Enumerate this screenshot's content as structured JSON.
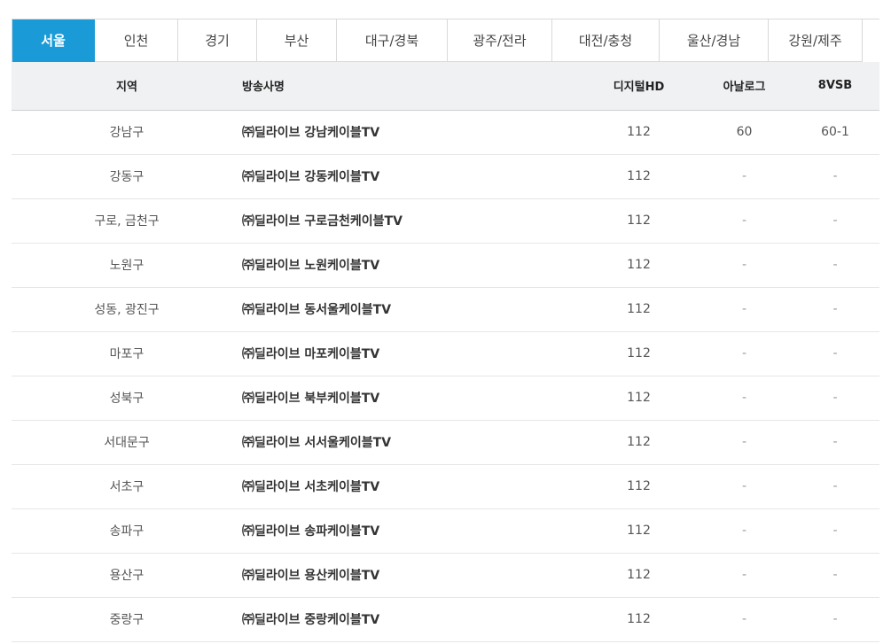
{
  "tabs": [
    {
      "label": "서울",
      "active": true
    },
    {
      "label": "인천",
      "active": false
    },
    {
      "label": "경기",
      "active": false
    },
    {
      "label": "부산",
      "active": false
    },
    {
      "label": "대구/경북",
      "active": false
    },
    {
      "label": "광주/전라",
      "active": false
    },
    {
      "label": "대전/충청",
      "active": false
    },
    {
      "label": "울산/경남",
      "active": false
    },
    {
      "label": "강원/제주",
      "active": false
    }
  ],
  "table": {
    "headers": {
      "region": "지역",
      "broadcaster": "방송사명",
      "digital_hd": "디지털HD",
      "analog": "아날로그",
      "vsb": "8VSB"
    },
    "rows": [
      {
        "region": "강남구",
        "broadcaster": "㈜딜라이브 강남케이블TV",
        "digital_hd": "112",
        "analog": "60",
        "vsb": "60-1"
      },
      {
        "region": "강동구",
        "broadcaster": "㈜딜라이브 강동케이블TV",
        "digital_hd": "112",
        "analog": "-",
        "vsb": "-"
      },
      {
        "region": "구로, 금천구",
        "broadcaster": "㈜딜라이브 구로금천케이블TV",
        "digital_hd": "112",
        "analog": "-",
        "vsb": "-"
      },
      {
        "region": "노원구",
        "broadcaster": "㈜딜라이브 노원케이블TV",
        "digital_hd": "112",
        "analog": "-",
        "vsb": "-"
      },
      {
        "region": "성동, 광진구",
        "broadcaster": "㈜딜라이브 동서울케이블TV",
        "digital_hd": "112",
        "analog": "-",
        "vsb": "-"
      },
      {
        "region": "마포구",
        "broadcaster": "㈜딜라이브 마포케이블TV",
        "digital_hd": "112",
        "analog": "-",
        "vsb": "-"
      },
      {
        "region": "성북구",
        "broadcaster": "㈜딜라이브 북부케이블TV",
        "digital_hd": "112",
        "analog": "-",
        "vsb": "-"
      },
      {
        "region": "서대문구",
        "broadcaster": "㈜딜라이브 서서울케이블TV",
        "digital_hd": "112",
        "analog": "-",
        "vsb": "-"
      },
      {
        "region": "서초구",
        "broadcaster": "㈜딜라이브 서초케이블TV",
        "digital_hd": "112",
        "analog": "-",
        "vsb": "-"
      },
      {
        "region": "송파구",
        "broadcaster": "㈜딜라이브 송파케이블TV",
        "digital_hd": "112",
        "analog": "-",
        "vsb": "-"
      },
      {
        "region": "용산구",
        "broadcaster": "㈜딜라이브 용산케이블TV",
        "digital_hd": "112",
        "analog": "-",
        "vsb": "-"
      },
      {
        "region": "중랑구",
        "broadcaster": "㈜딜라이브 중랑케이블TV",
        "digital_hd": "112",
        "analog": "-",
        "vsb": "-"
      }
    ]
  },
  "colors": {
    "active_tab": "#1a9bd7",
    "header_bg": "#f0f1f3"
  }
}
